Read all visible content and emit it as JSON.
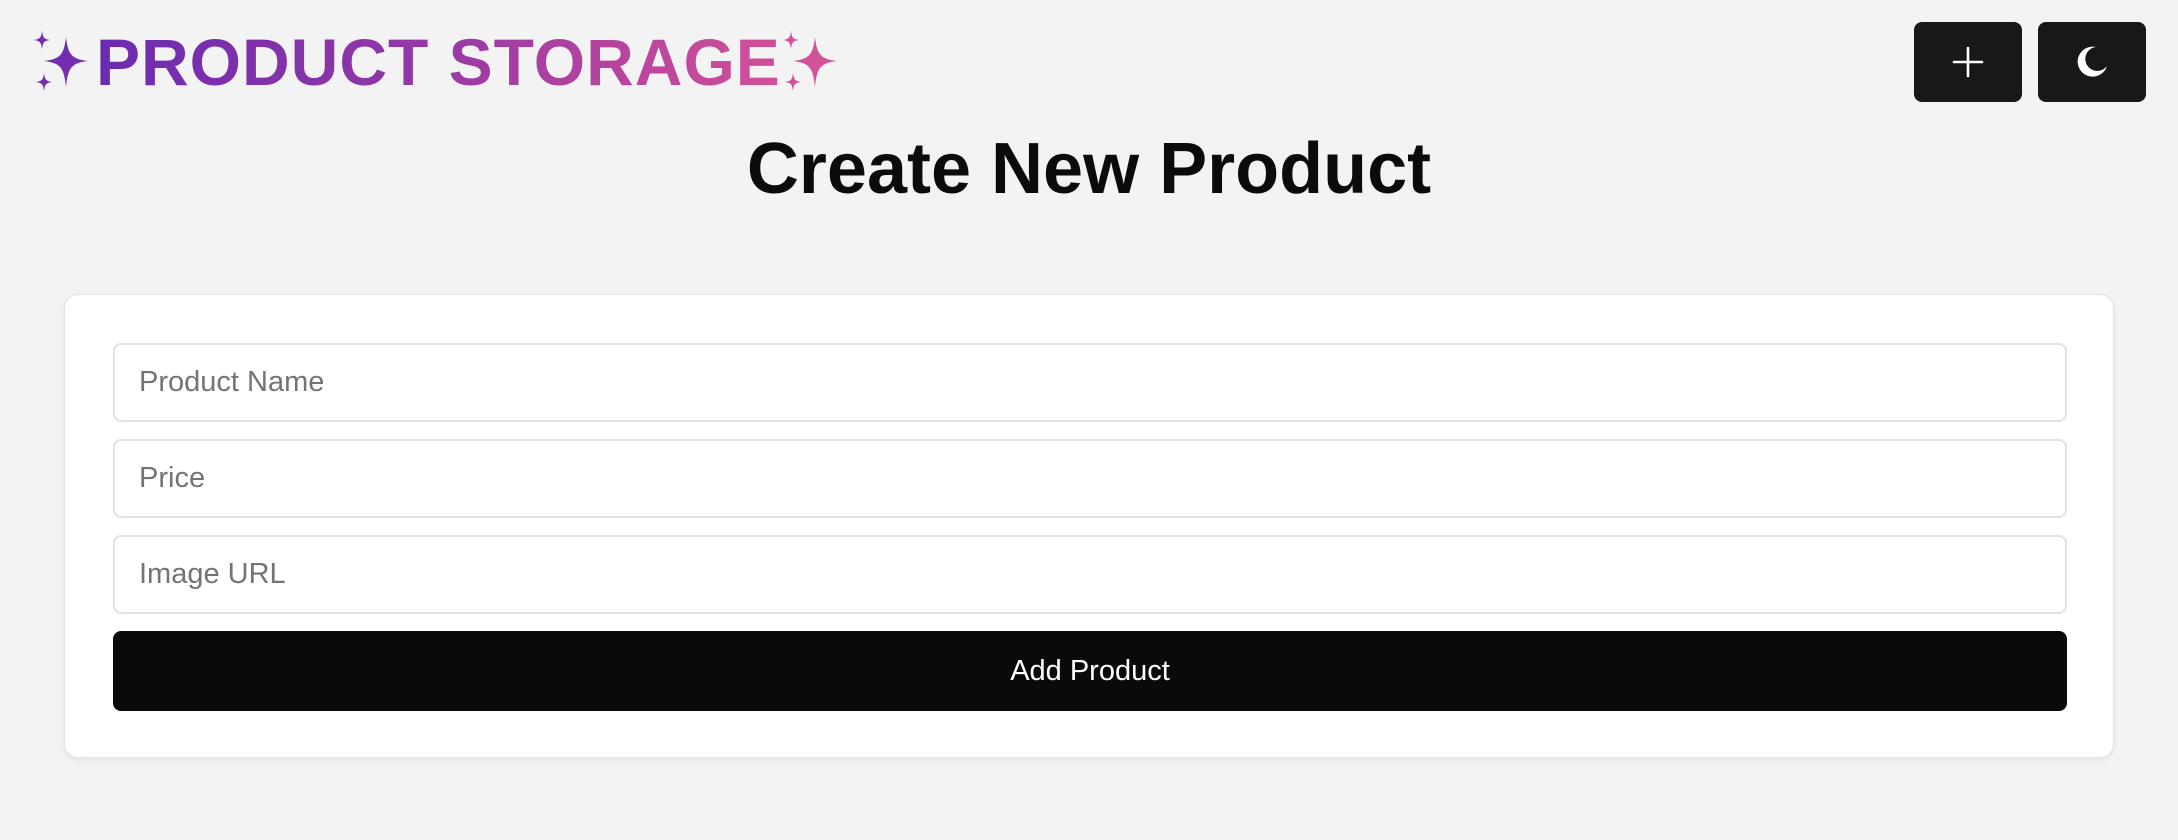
{
  "header": {
    "brand_prefix_icon": "sparkles-icon",
    "brand_text": "PRODUCT STORAGE",
    "brand_suffix_icon": "sparkles-icon",
    "brand_gradient": [
      "#6b2bb0",
      "#d24f98"
    ],
    "create_button_icon": "plus-icon",
    "theme_button_icon": "moon-icon"
  },
  "main": {
    "title": "Create New Product",
    "form": {
      "name_placeholder": "Product Name",
      "name_value": "",
      "price_placeholder": "Price",
      "price_value": "",
      "image_placeholder": "Image URL",
      "image_value": "",
      "submit_label": "Add Product"
    }
  },
  "colors": {
    "page_background": "#f3f3f3",
    "button_dark": "#18181b",
    "submit_background": "#0a0a0c",
    "card_background": "#ffffff"
  }
}
